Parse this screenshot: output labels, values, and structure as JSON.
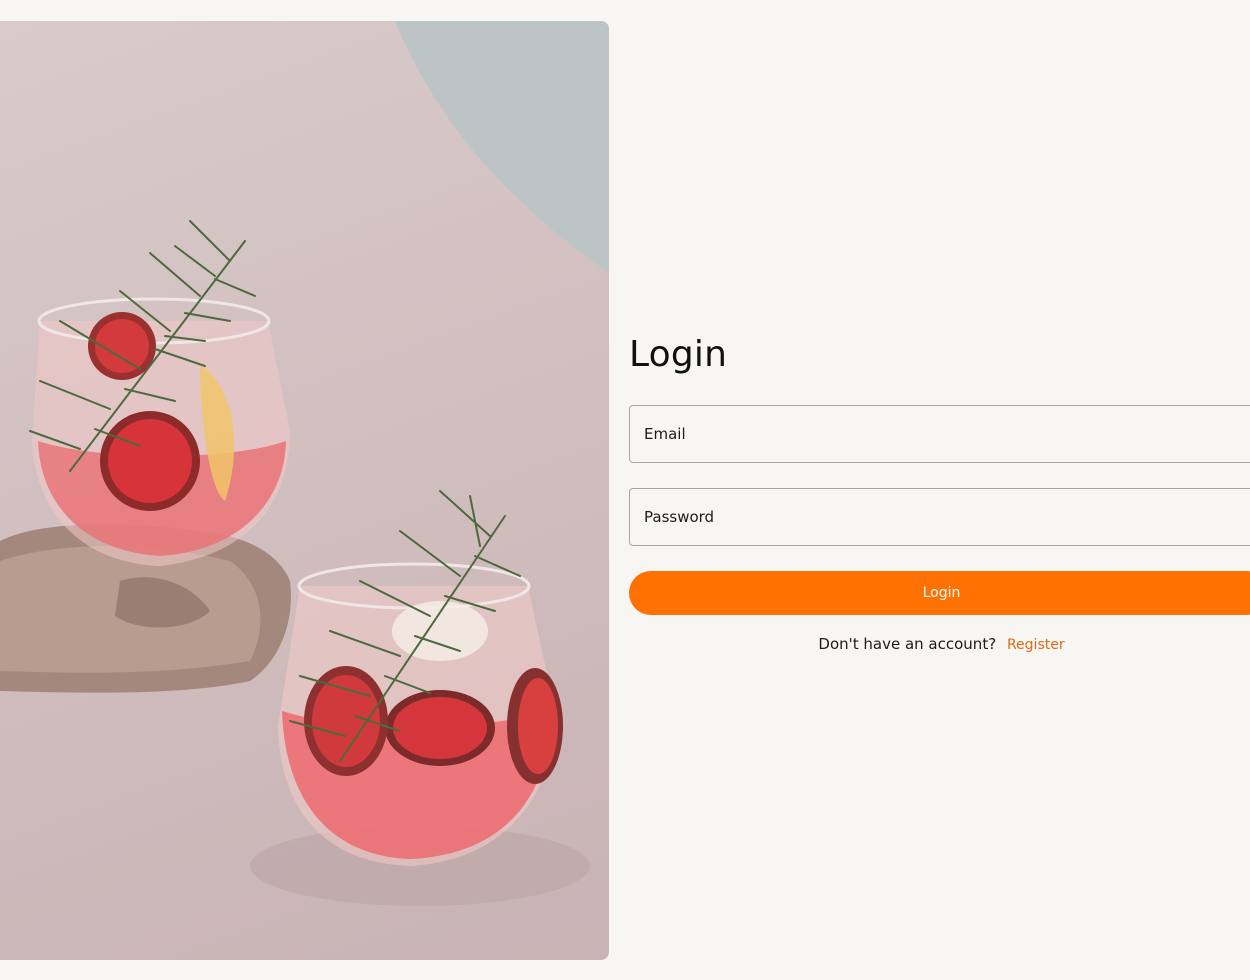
{
  "login": {
    "title": "Login",
    "email_placeholder": "Email",
    "password_placeholder": "Password",
    "submit_label": "Login",
    "no_account_text": "Don't have an account?",
    "register_link": "Register"
  },
  "colors": {
    "accent": "#ff7102",
    "link": "#e06a1a",
    "background": "#f8f6f2"
  }
}
